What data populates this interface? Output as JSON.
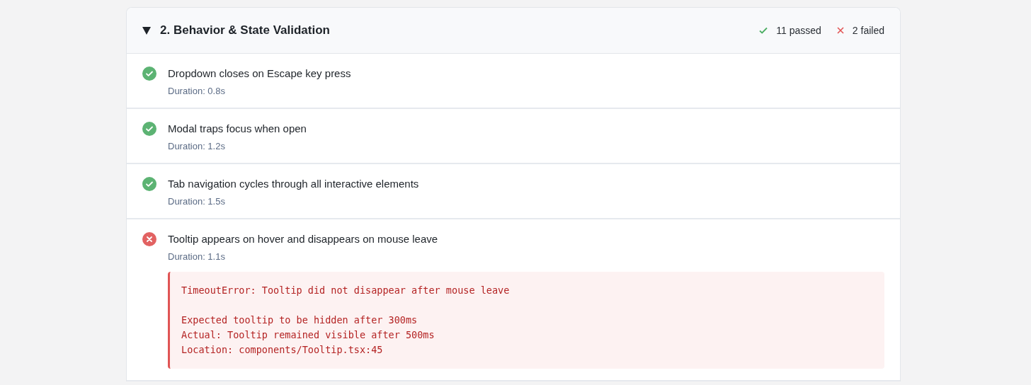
{
  "section": {
    "title": "2. Behavior & State Validation",
    "expanded": true,
    "summary": [
      {
        "kind": "passed",
        "label": "11 passed"
      },
      {
        "kind": "failed",
        "label": "2 failed"
      }
    ]
  },
  "tests": [
    {
      "passed": true,
      "name": "Dropdown closes on Escape key press",
      "duration": "Duration: 0.8s"
    },
    {
      "passed": true,
      "name": "Modal traps focus when open",
      "duration": "Duration: 1.2s"
    },
    {
      "passed": true,
      "name": "Tab navigation cycles through all interactive elements",
      "duration": "Duration: 1.5s"
    },
    {
      "passed": false,
      "name": "Tooltip appears on hover and disappears on mouse leave",
      "duration": "Duration: 1.1s",
      "error": {
        "message": "TimeoutError: Tooltip did not disappear after mouse leave",
        "details": [
          "Expected tooltip to be hidden after 300ms",
          "Actual: Tooltip remained visible after 500ms",
          "Location: components/Tooltip.tsx:45"
        ]
      }
    }
  ]
}
